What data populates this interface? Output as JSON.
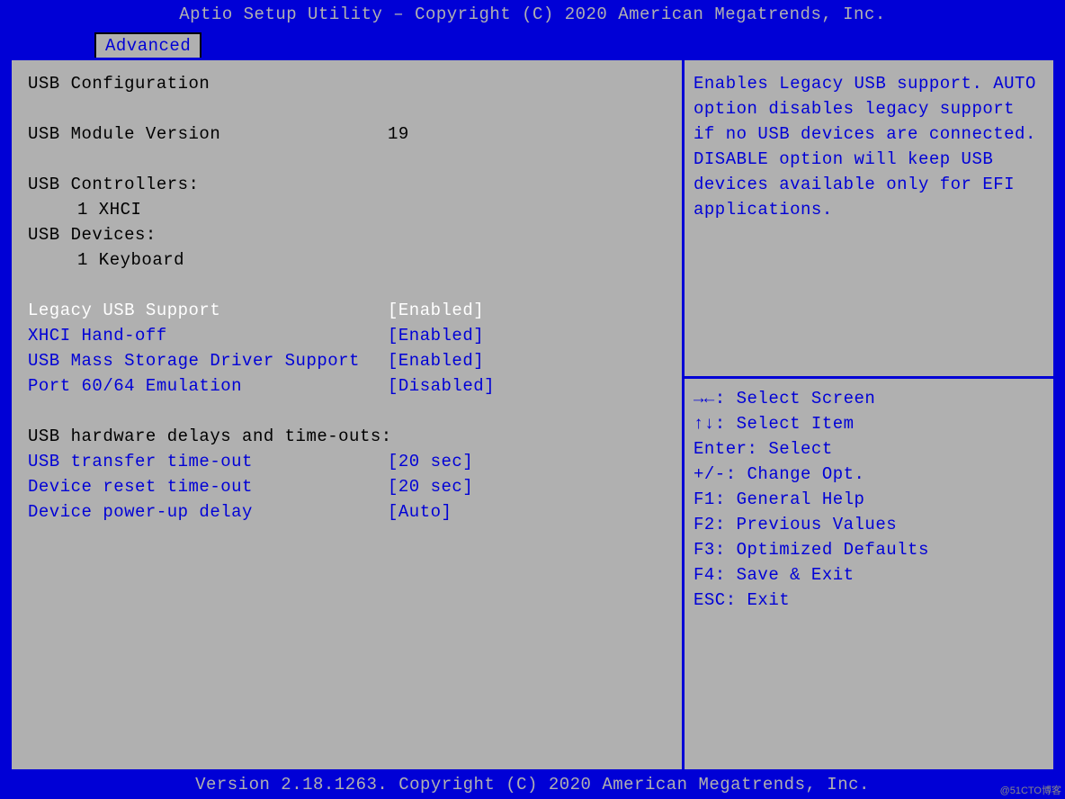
{
  "header": {
    "title": "Aptio Setup Utility – Copyright (C) 2020 American Megatrends, Inc."
  },
  "tabs": {
    "active": "Advanced"
  },
  "left": {
    "section_title": "USB Configuration",
    "module_version_label": "USB Module Version",
    "module_version_value": "19",
    "controllers_label": "USB Controllers:",
    "controllers_value": "1 XHCI",
    "devices_label": "USB Devices:",
    "devices_value": "1 Keyboard",
    "options": [
      {
        "label": "Legacy USB Support",
        "value": "[Enabled]",
        "selected": true
      },
      {
        "label": "XHCI Hand-off",
        "value": "[Enabled]",
        "selected": false
      },
      {
        "label": "USB Mass Storage Driver Support",
        "value": "[Enabled]",
        "selected": false
      },
      {
        "label": "Port 60/64 Emulation",
        "value": "[Disabled]",
        "selected": false
      }
    ],
    "delays_title": "USB hardware delays and time-outs:",
    "delays": [
      {
        "label": "USB transfer time-out",
        "value": "[20 sec]"
      },
      {
        "label": "Device reset time-out",
        "value": "[20 sec]"
      },
      {
        "label": "Device power-up delay",
        "value": "[Auto]"
      }
    ]
  },
  "help": {
    "text": "Enables Legacy USB support. AUTO option disables legacy support if no USB devices are connected. DISABLE option will keep USB devices available only for EFI applications.",
    "keys": [
      "→←: Select Screen",
      "↑↓: Select Item",
      "Enter: Select",
      "+/-: Change Opt.",
      "F1: General Help",
      "F2: Previous Values",
      "F3: Optimized Defaults",
      "F4: Save & Exit",
      "ESC: Exit"
    ]
  },
  "footer": {
    "text": "Version 2.18.1263. Copyright (C) 2020 American Megatrends, Inc."
  },
  "watermark": "@51CTO博客"
}
